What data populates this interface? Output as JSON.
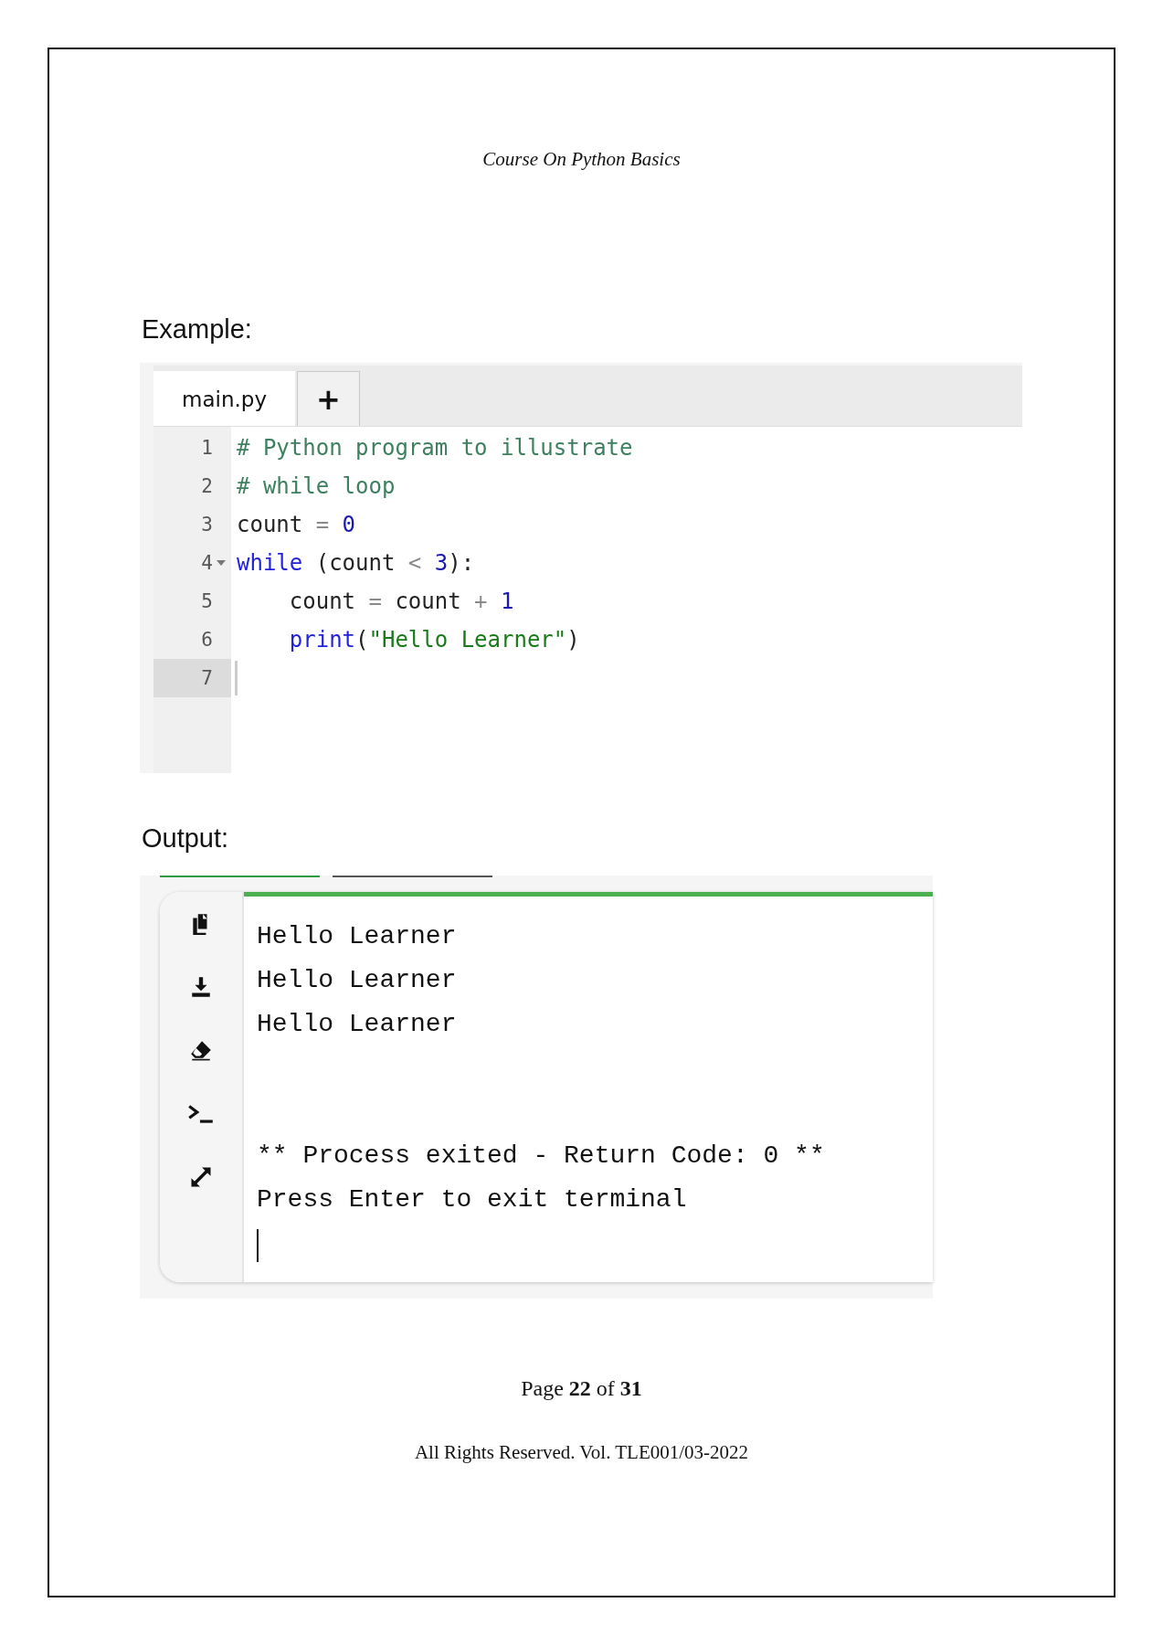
{
  "header": "Course On Python Basics",
  "example_heading": "Example:",
  "editor": {
    "tabs": [
      {
        "label": "main.py",
        "kind": "file",
        "selected": true
      },
      {
        "label": "+",
        "kind": "add",
        "selected": false
      }
    ],
    "lines": [
      {
        "number": "1",
        "foldable": false,
        "active": false,
        "tokens": [
          {
            "text": "# Python program to illustrate",
            "kind": "comment"
          }
        ]
      },
      {
        "number": "2",
        "foldable": false,
        "active": false,
        "tokens": [
          {
            "text": "# while loop",
            "kind": "comment"
          }
        ]
      },
      {
        "number": "3",
        "foldable": false,
        "active": false,
        "tokens": [
          {
            "text": "count ",
            "kind": "plain"
          },
          {
            "text": "=",
            "kind": "operator"
          },
          {
            "text": " 0",
            "kind": "number"
          }
        ]
      },
      {
        "number": "4",
        "foldable": true,
        "active": false,
        "tokens": [
          {
            "text": "while",
            "kind": "keyword"
          },
          {
            "text": " (count ",
            "kind": "plain"
          },
          {
            "text": "<",
            "kind": "operator"
          },
          {
            "text": " 3",
            "kind": "number"
          },
          {
            "text": "):",
            "kind": "plain"
          }
        ]
      },
      {
        "number": "5",
        "foldable": false,
        "active": false,
        "tokens": [
          {
            "text": "    count ",
            "kind": "plain"
          },
          {
            "text": "=",
            "kind": "operator"
          },
          {
            "text": " count ",
            "kind": "plain"
          },
          {
            "text": "+",
            "kind": "operator"
          },
          {
            "text": " 1",
            "kind": "number"
          }
        ]
      },
      {
        "number": "6",
        "foldable": false,
        "active": false,
        "tokens": [
          {
            "text": "    print",
            "kind": "builtin"
          },
          {
            "text": "(",
            "kind": "plain"
          },
          {
            "text": "\"Hello Learner\"",
            "kind": "string"
          },
          {
            "text": ")",
            "kind": "plain"
          }
        ]
      },
      {
        "number": "7",
        "foldable": false,
        "active": true
      }
    ]
  },
  "output_heading": "Output:",
  "terminal": {
    "output_lines": [
      "Hello Learner",
      "Hello Learner",
      "Hello Learner"
    ],
    "exit_lines": [
      "** Process exited - Return Code: 0 **",
      "Press Enter to exit terminal"
    ]
  },
  "footer": {
    "page": "Page **22** of **31**",
    "rights": "All Rights Reserved. Vol. TLE001/03-2022"
  }
}
